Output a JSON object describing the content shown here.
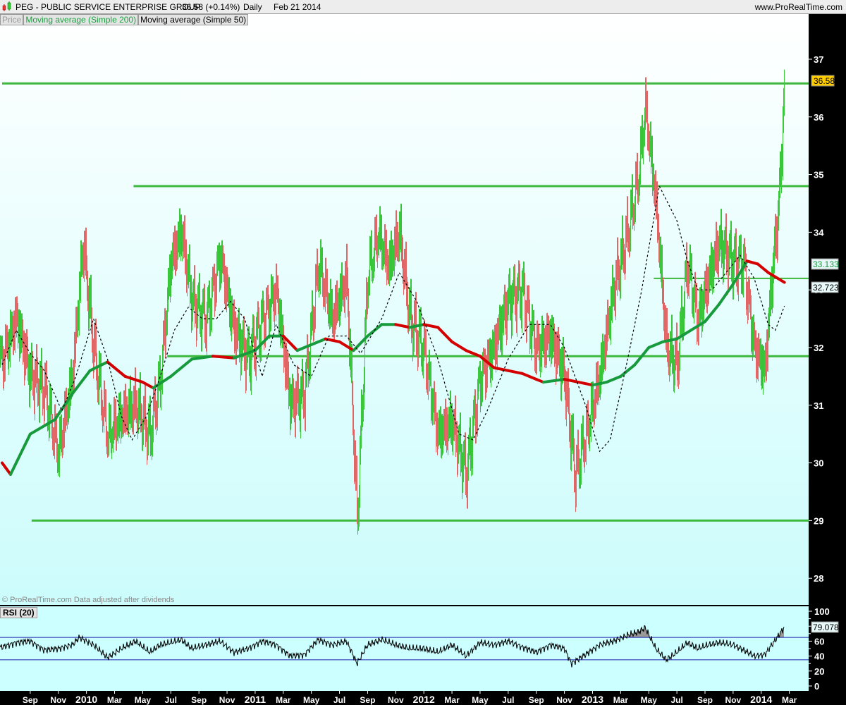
{
  "header": {
    "symbol_title": "PEG - PUBLIC SERVICE ENTERPRISE GROUP",
    "price_change": "36.58 (+0.14%)",
    "period": "Daily",
    "date": "Feb 21 2014",
    "site": "www.ProRealTime.com"
  },
  "legend": {
    "price": "Price",
    "ma200": "Moving average (Simple 200)",
    "ma50": "Moving average (Simple 50)"
  },
  "copyright": "© ProRealTime.com Data adjusted after dividends",
  "rsi_label": "RSI (20)",
  "colors": {
    "up": "#3cc83c",
    "down": "#e06464",
    "ma_up": "#169a3c",
    "ma_down": "#d40000",
    "level": "#3cb83c",
    "rsi_band": "#2020b0"
  },
  "chart_data": [
    {
      "type": "line",
      "title": "PEG - PUBLIC SERVICE ENTERPRISE GROUP Daily",
      "x_unit": "months since Jul 2009",
      "xlim": [
        0,
        58
      ],
      "ylim": [
        27.6,
        37.8
      ],
      "y_ticks": [
        28,
        29,
        30,
        31,
        32,
        33,
        34,
        35,
        36,
        37
      ],
      "x_tick_labels": [
        "Sep",
        "Nov",
        "2010",
        "Mar",
        "May",
        "Jul",
        "Sep",
        "Nov",
        "2011",
        "Mar",
        "May",
        "Jul",
        "Sep",
        "Nov",
        "2012",
        "Mar",
        "May",
        "Jul",
        "Sep",
        "Nov",
        "2013",
        "Mar",
        "May",
        "Jul",
        "Sep",
        "Nov",
        "2014",
        "Mar"
      ],
      "x_tick_months": [
        2,
        4,
        6,
        8,
        10,
        12,
        14,
        16,
        18,
        20,
        22,
        24,
        26,
        28,
        30,
        32,
        34,
        36,
        38,
        40,
        42,
        44,
        46,
        48,
        50,
        52,
        54,
        56
      ],
      "last_price_label": "36.58",
      "ma200_label": "33.133",
      "ma50_label": "32.723",
      "price": [
        [
          0,
          31.8
        ],
        [
          1,
          32.5
        ],
        [
          2,
          31.5
        ],
        [
          3,
          31.3
        ],
        [
          4,
          30.2
        ],
        [
          5,
          31.5
        ],
        [
          5.75,
          33.8
        ],
        [
          6.5,
          32
        ],
        [
          7.5,
          30.5
        ],
        [
          8.5,
          30.8
        ],
        [
          9.5,
          31
        ],
        [
          10.5,
          30.5
        ],
        [
          11.25,
          31.5
        ],
        [
          12,
          33.5
        ],
        [
          12.75,
          34
        ],
        [
          13.5,
          32.8
        ],
        [
          14.5,
          32.5
        ],
        [
          15.5,
          33.6
        ],
        [
          16.5,
          32.3
        ],
        [
          17.5,
          31.8
        ],
        [
          18.5,
          32.5
        ],
        [
          19.5,
          33
        ],
        [
          20.5,
          31
        ],
        [
          21.5,
          31.2
        ],
        [
          22.5,
          33.5
        ],
        [
          23.5,
          32.5
        ],
        [
          24.5,
          33.2
        ],
        [
          25.25,
          29
        ],
        [
          26,
          33.3
        ],
        [
          26.75,
          34
        ],
        [
          27.5,
          33.4
        ],
        [
          28.25,
          34
        ],
        [
          29,
          32.5
        ],
        [
          30,
          32
        ],
        [
          31,
          30.5
        ],
        [
          32,
          30.7
        ],
        [
          33,
          29.8
        ],
        [
          34,
          31.5
        ],
        [
          35,
          32
        ],
        [
          36,
          32.8
        ],
        [
          37,
          33
        ],
        [
          38,
          32
        ],
        [
          39,
          32.2
        ],
        [
          40,
          31.5
        ],
        [
          40.75,
          29.8
        ],
        [
          41.5,
          30.5
        ],
        [
          42.5,
          31.5
        ],
        [
          43.5,
          33
        ],
        [
          44.5,
          34
        ],
        [
          45.25,
          35
        ],
        [
          45.75,
          36.2
        ],
        [
          46.5,
          34.5
        ],
        [
          47.25,
          32
        ],
        [
          48,
          31.7
        ],
        [
          48.75,
          33.5
        ],
        [
          49.5,
          32.5
        ],
        [
          50.25,
          33.2
        ],
        [
          51,
          33.8
        ],
        [
          52,
          33.5
        ],
        [
          52.75,
          33.5
        ],
        [
          53.5,
          32
        ],
        [
          54.25,
          31.6
        ],
        [
          54.75,
          33.2
        ],
        [
          55.25,
          34.5
        ],
        [
          55.65,
          36.58
        ]
      ],
      "ma200": [
        [
          0,
          30.0
        ],
        [
          0.6,
          29.8
        ],
        [
          2,
          30.5
        ],
        [
          3.75,
          30.75
        ],
        [
          5,
          31.2
        ],
        [
          6.25,
          31.6
        ],
        [
          7.5,
          31.75
        ],
        [
          8.75,
          31.5
        ],
        [
          10,
          31.4
        ],
        [
          10.75,
          31.3
        ],
        [
          12,
          31.5
        ],
        [
          13.5,
          31.8
        ],
        [
          15,
          31.85
        ],
        [
          16.5,
          31.82
        ],
        [
          18,
          31.95
        ],
        [
          19,
          32.2
        ],
        [
          20,
          32.2
        ],
        [
          21,
          31.95
        ],
        [
          22,
          32.05
        ],
        [
          23,
          32.15
        ],
        [
          24,
          32.1
        ],
        [
          25,
          31.95
        ],
        [
          26,
          32.2
        ],
        [
          27,
          32.4
        ],
        [
          28,
          32.4
        ],
        [
          29,
          32.35
        ],
        [
          30,
          32.4
        ],
        [
          31,
          32.35
        ],
        [
          32,
          32.1
        ],
        [
          33,
          31.95
        ],
        [
          34,
          31.85
        ],
        [
          35,
          31.65
        ],
        [
          36,
          31.6
        ],
        [
          37,
          31.55
        ],
        [
          38,
          31.45
        ],
        [
          38.5,
          31.4
        ],
        [
          40,
          31.45
        ],
        [
          41,
          31.4
        ],
        [
          42,
          31.35
        ],
        [
          43,
          31.4
        ],
        [
          44,
          31.5
        ],
        [
          45,
          31.7
        ],
        [
          46,
          32.0
        ],
        [
          47,
          32.1
        ],
        [
          48,
          32.15
        ],
        [
          49,
          32.3
        ],
        [
          50,
          32.45
        ],
        [
          51,
          32.75
        ],
        [
          52,
          33.1
        ],
        [
          53,
          33.5
        ],
        [
          53.75,
          33.45
        ],
        [
          54.5,
          33.3
        ],
        [
          55.65,
          33.13
        ]
      ],
      "ma50": [
        [
          0,
          31.7
        ],
        [
          1,
          32.3
        ],
        [
          2,
          31.9
        ],
        [
          3,
          31.6
        ],
        [
          4.25,
          30.9
        ],
        [
          5.25,
          31.5
        ],
        [
          6.5,
          32.5
        ],
        [
          7.5,
          31.8
        ],
        [
          8.5,
          30.8
        ],
        [
          9.25,
          30.4
        ],
        [
          10.25,
          30.8
        ],
        [
          11.25,
          31.5
        ],
        [
          12.25,
          32.3
        ],
        [
          13.25,
          32.7
        ],
        [
          14.25,
          32.5
        ],
        [
          15.25,
          32.5
        ],
        [
          16.25,
          32.8
        ],
        [
          17.25,
          32.5
        ],
        [
          18.5,
          31.5
        ],
        [
          19.5,
          32.4
        ],
        [
          20.75,
          31.7
        ],
        [
          22,
          31.5
        ],
        [
          23.25,
          32.2
        ],
        [
          24.5,
          32.2
        ],
        [
          25.5,
          31.9
        ],
        [
          27,
          32.5
        ],
        [
          28.25,
          33.3
        ],
        [
          29.5,
          32.8
        ],
        [
          31,
          31.8
        ],
        [
          32.5,
          30.5
        ],
        [
          33.5,
          30.4
        ],
        [
          34.5,
          30.9
        ],
        [
          36,
          31.8
        ],
        [
          37.5,
          32.4
        ],
        [
          39,
          32.4
        ],
        [
          40,
          32.0
        ],
        [
          41.5,
          31.0
        ],
        [
          42.5,
          30.2
        ],
        [
          43.25,
          30.4
        ],
        [
          44.5,
          31.8
        ],
        [
          45.5,
          33.0
        ],
        [
          46.75,
          34.8
        ],
        [
          48,
          34.2
        ],
        [
          48.75,
          33.5
        ],
        [
          49.5,
          33.0
        ],
        [
          50.5,
          33.0
        ],
        [
          51.5,
          33.3
        ],
        [
          52.5,
          33.6
        ],
        [
          53.5,
          33.2
        ],
        [
          54.5,
          32.4
        ],
        [
          55,
          32.3
        ],
        [
          55.65,
          32.72
        ]
      ],
      "levels": [
        {
          "price": 36.58,
          "from_month": 0
        },
        {
          "price": 34.8,
          "from_month": 9.35
        },
        {
          "price": 31.85,
          "from_month": 11.75
        },
        {
          "price": 29.0,
          "from_month": 2.1
        },
        {
          "price": 33.2,
          "from_month": 46.35
        }
      ]
    },
    {
      "type": "line",
      "title": "RSI (20)",
      "ylim": [
        0,
        100
      ],
      "y_ticks": [
        0,
        20,
        40,
        60,
        80,
        100
      ],
      "bands": [
        35,
        65
      ],
      "last_value_label": "79.078",
      "rsi": [
        [
          0,
          52
        ],
        [
          1,
          58
        ],
        [
          2,
          60
        ],
        [
          3,
          48
        ],
        [
          4,
          50
        ],
        [
          5,
          55
        ],
        [
          5.5,
          65
        ],
        [
          6.5,
          55
        ],
        [
          7.5,
          38
        ],
        [
          8.5,
          50
        ],
        [
          9.5,
          60
        ],
        [
          10.5,
          45
        ],
        [
          11.25,
          55
        ],
        [
          12,
          58
        ],
        [
          12.75,
          62
        ],
        [
          13.5,
          50
        ],
        [
          14.5,
          55
        ],
        [
          15.5,
          60
        ],
        [
          16.5,
          45
        ],
        [
          17.5,
          50
        ],
        [
          18.5,
          60
        ],
        [
          19.5,
          55
        ],
        [
          20.5,
          40
        ],
        [
          21.5,
          42
        ],
        [
          22.5,
          62
        ],
        [
          23.5,
          55
        ],
        [
          24.5,
          60
        ],
        [
          25.25,
          30
        ],
        [
          26,
          55
        ],
        [
          27,
          62
        ],
        [
          28,
          55
        ],
        [
          29,
          50
        ],
        [
          30,
          50
        ],
        [
          31,
          45
        ],
        [
          32,
          55
        ],
        [
          33,
          40
        ],
        [
          34,
          58
        ],
        [
          35,
          55
        ],
        [
          36,
          60
        ],
        [
          37,
          52
        ],
        [
          38,
          45
        ],
        [
          39,
          55
        ],
        [
          40,
          50
        ],
        [
          40.5,
          30
        ],
        [
          41.5,
          42
        ],
        [
          42.5,
          55
        ],
        [
          43.5,
          60
        ],
        [
          44.5,
          68
        ],
        [
          45.25,
          72
        ],
        [
          45.75,
          78
        ],
        [
          46.5,
          50
        ],
        [
          47.25,
          35
        ],
        [
          48,
          45
        ],
        [
          48.75,
          58
        ],
        [
          49.5,
          50
        ],
        [
          50.25,
          55
        ],
        [
          51,
          58
        ],
        [
          52,
          55
        ],
        [
          52.75,
          48
        ],
        [
          53.5,
          40
        ],
        [
          54.25,
          42
        ],
        [
          54.75,
          55
        ],
        [
          55.25,
          68
        ],
        [
          55.65,
          79
        ]
      ]
    }
  ]
}
